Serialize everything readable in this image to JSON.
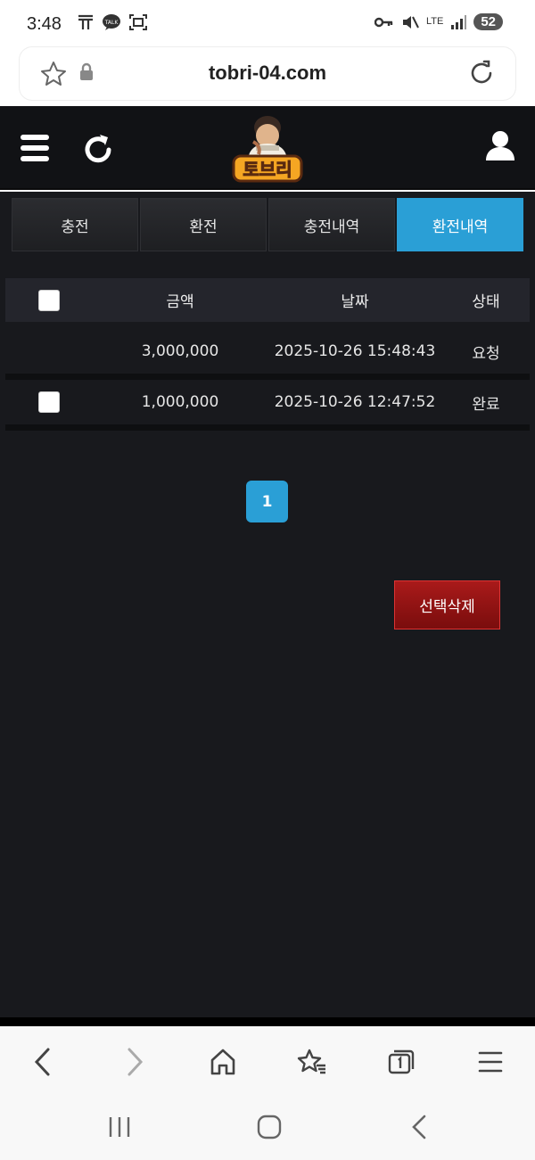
{
  "status_bar": {
    "time": "3:48",
    "battery": "52",
    "network": "LTE"
  },
  "browser": {
    "url": "tobri-04.com"
  },
  "site": {
    "logo_text": "토브리",
    "tabs": [
      {
        "label": "충전",
        "active": false
      },
      {
        "label": "환전",
        "active": false
      },
      {
        "label": "충전내역",
        "active": false
      },
      {
        "label": "환전내역",
        "active": true
      }
    ],
    "table": {
      "headers": {
        "amount": "금액",
        "date": "날짜",
        "status": "상태"
      },
      "rows": [
        {
          "has_checkbox": false,
          "amount": "3,000,000",
          "date": "2025-10-26 15:48:43",
          "status": "요청"
        },
        {
          "has_checkbox": true,
          "amount": "1,000,000",
          "date": "2025-10-26 12:47:52",
          "status": "완료"
        }
      ]
    },
    "pagination": {
      "current": "1"
    },
    "delete_button": "선택삭제"
  },
  "colors": {
    "accent": "#2a9fd6",
    "header_bg": "#111215",
    "main_bg": "#18191d",
    "delete_red": "#a91a1a"
  }
}
